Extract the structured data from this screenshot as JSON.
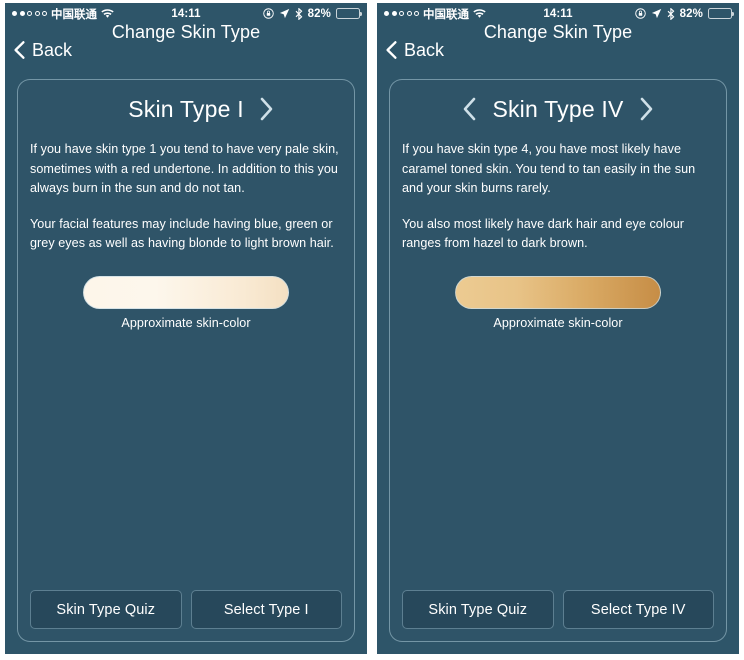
{
  "panels": [
    {
      "status": {
        "signal_filled": 2,
        "signal_total": 5,
        "carrier": "中国联通",
        "wifi_icon": "wifi-icon",
        "time": "14:11",
        "rotation_lock_icon": "rotation-lock-icon",
        "location_icon": "location-arrow-icon",
        "bluetooth_icon": "bluetooth-icon",
        "battery_percent": "82%",
        "battery_level": 82,
        "battery_color": "#f5c518"
      },
      "nav": {
        "back_label": "Back",
        "back_icon": "chevron-left-icon",
        "title": "Change Skin Type"
      },
      "card": {
        "prev_icon": "chevron-left-icon",
        "next_icon": "chevron-right-icon",
        "show_prev": false,
        "show_next": true,
        "title": "Skin Type I",
        "paragraph1": "If you have skin type 1 you tend to have very pale skin, sometimes with a red undertone. In addition to this you always burn in the sun and do not tan.",
        "paragraph2": "Your facial features may include having blue, green or grey eyes as well as having blonde to light brown hair.",
        "swatch_caption": "Approximate skin-color",
        "swatch_color_start": "#fdf6ea",
        "swatch_color_end": "#f6e3c9"
      },
      "buttons": {
        "quiz_label": "Skin Type Quiz",
        "select_label": "Select Type I"
      }
    },
    {
      "status": {
        "signal_filled": 2,
        "signal_total": 5,
        "carrier": "中国联通",
        "wifi_icon": "wifi-icon",
        "time": "14:11",
        "rotation_lock_icon": "rotation-lock-icon",
        "location_icon": "location-arrow-icon",
        "bluetooth_icon": "bluetooth-icon",
        "battery_percent": "82%",
        "battery_level": 82,
        "battery_color": "#f5c518"
      },
      "nav": {
        "back_label": "Back",
        "back_icon": "chevron-left-icon",
        "title": "Change Skin Type"
      },
      "card": {
        "prev_icon": "chevron-left-icon",
        "next_icon": "chevron-right-icon",
        "show_prev": true,
        "show_next": true,
        "title": "Skin Type IV",
        "paragraph1": "If you have skin type 4, you have most likely have caramel toned skin. You tend to tan easily in the sun and your skin burns rarely.",
        "paragraph2": "You also most likely have dark hair and eye colour ranges from hazel to dark brown.",
        "swatch_caption": "Approximate skin-color",
        "swatch_color_start": "#eccb92",
        "swatch_color_end": "#c68d46"
      },
      "buttons": {
        "quiz_label": "Skin Type Quiz",
        "select_label": "Select Type IV"
      }
    }
  ],
  "theme": {
    "screen_background": "#2e5569",
    "card_background": "#2f5468",
    "button_background": "#27485b",
    "text_color": "#ffffff",
    "border_color": "#adccd8"
  }
}
